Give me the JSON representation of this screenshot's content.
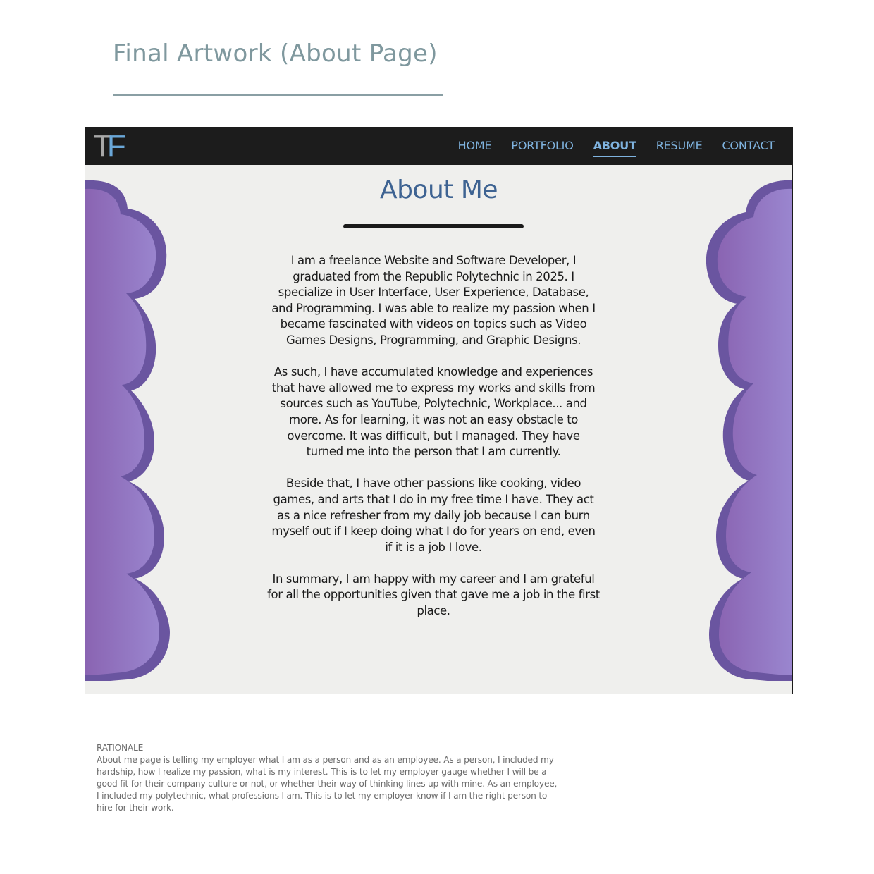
{
  "sheet": {
    "title": "Final Artwork (About Page)"
  },
  "nav": {
    "logo_letters": [
      "T",
      "F"
    ],
    "items": [
      {
        "label": "HOME",
        "active": false
      },
      {
        "label": "PORTFOLIO",
        "active": false
      },
      {
        "label": "ABOUT",
        "active": true
      },
      {
        "label": "RESUME",
        "active": false
      },
      {
        "label": "CONTACT",
        "active": false
      }
    ]
  },
  "about": {
    "heading": "About Me",
    "paragraphs": [
      "I am a freelance Website and Software Developer, I graduated from the Republic Polytechnic in 2025. I specialize in User Interface, User Experience, Database, and Programming. I was able to realize my passion when I became fascinated with videos on topics such as Video Games Designs, Programming, and Graphic Designs.",
      "As such, I have accumulated knowledge and experiences that have allowed me to express my works and skills from sources such as YouTube, Polytechnic, Workplace... and more. As for learning, it was not an easy obstacle to overcome. It was difficult, but I managed. They have turned me into the person that I am currently.",
      "Beside that, I have other passions like cooking, video games, and arts that I do in my free time I have. They act as a nice refresher from my daily job because I can burn myself out if I keep doing what I do for years on end, even if it is a job I love.",
      "In summary, I am happy with my career and I am grateful for all the opportunities given that gave me a job in the first place."
    ]
  },
  "rationale": {
    "label": "RATIONALE",
    "text": "About me page is telling my employer what I am as a person and as an employee. As a person, I included my hardship, how I realize my passion, what is my interest. This is to let my employer gauge whether I will be a good fit for their company culture or not, or whether their way of thinking lines up with mine. As an employee, I included my polytechnic, what professions I am. This is to let my employer know if I am the right person to hire for their work."
  },
  "colors": {
    "navbar": "#1c1c1c",
    "nav_link": "#7fb3df",
    "heading": "#3e6392",
    "cloud_fill": "#8c6bba",
    "cloud_border": "#6a55a0",
    "page_background": "#efefed"
  }
}
